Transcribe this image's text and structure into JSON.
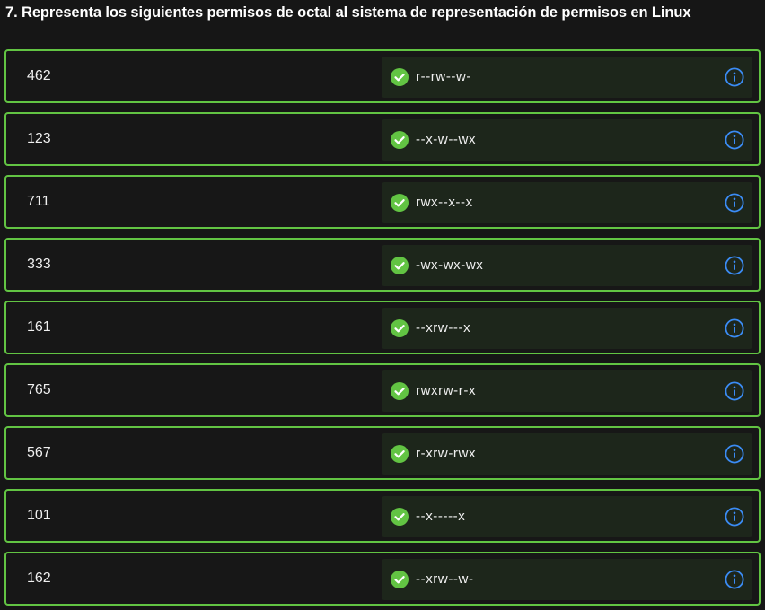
{
  "question": {
    "title": "7. Representa los siguientes permisos de octal al sistema de representación de permisos en Linux"
  },
  "colors": {
    "correct_border": "#62c443",
    "check_fill": "#62c443",
    "info_blue": "#3b8cf5",
    "answer_bg": "#1d261b",
    "page_bg": "#161616"
  },
  "icons": {
    "status": "check-circle-icon",
    "info": "info-circle-icon"
  },
  "rows": [
    {
      "octal": "462",
      "answer": "r--rw--w-",
      "status": "correct"
    },
    {
      "octal": "123",
      "answer": "--x-w--wx",
      "status": "correct"
    },
    {
      "octal": "711",
      "answer": "rwx--x--x",
      "status": "correct"
    },
    {
      "octal": "333",
      "answer": "-wx-wx-wx",
      "status": "correct"
    },
    {
      "octal": "161",
      "answer": "--xrw---x",
      "status": "correct"
    },
    {
      "octal": "765",
      "answer": "rwxrw-r-x",
      "status": "correct"
    },
    {
      "octal": "567",
      "answer": "r-xrw-rwx",
      "status": "correct"
    },
    {
      "octal": "101",
      "answer": "--x-----x",
      "status": "correct"
    },
    {
      "octal": "162",
      "answer": "--xrw--w-",
      "status": "correct"
    }
  ]
}
